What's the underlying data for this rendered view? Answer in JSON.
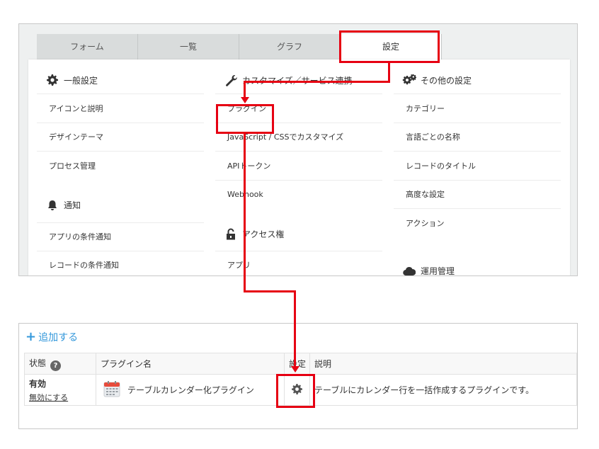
{
  "tabs": [
    {
      "label": "フォーム",
      "active": false
    },
    {
      "label": "一覧",
      "active": false
    },
    {
      "label": "グラフ",
      "active": false
    },
    {
      "label": "設定",
      "active": true
    }
  ],
  "columns": {
    "general": {
      "heading": "一般設定",
      "icon": "gear-icon",
      "items": [
        "アイコンと説明",
        "デザインテーマ",
        "プロセス管理"
      ],
      "sub_heading": "通知",
      "sub_icon": "bell-icon",
      "sub_items": [
        "アプリの条件通知",
        "レコードの条件通知"
      ]
    },
    "customize": {
      "heading": "カスタマイズ／サービス連携",
      "icon": "wrench-icon",
      "items": [
        "プラグイン",
        "JavaScript / CSSでカスタマイズ",
        "APIトークン",
        "Webhook"
      ],
      "sub_heading": "アクセス権",
      "sub_icon": "lock-icon",
      "sub_items": [
        "アプリ"
      ]
    },
    "other": {
      "heading": "その他の設定",
      "icon": "gears-icon",
      "items": [
        "カテゴリー",
        "言語ごとの名称",
        "レコードのタイトル",
        "高度な設定",
        "アクション"
      ],
      "sub_heading": "運用管理",
      "sub_icon": "cloud-icon"
    }
  },
  "plugins": {
    "add_label": "追加する",
    "headers": {
      "status": "状態",
      "name": "プラグイン名",
      "settings": "設定",
      "description": "説明"
    },
    "help_badge": "?",
    "rows": [
      {
        "status": "有効",
        "status_action": "無効にする",
        "name": "テーブルカレンダー化プラグイン",
        "description": "テーブルにカレンダー行を一括作成するプラグインです。"
      }
    ]
  },
  "colors": {
    "highlight": "#e60012",
    "link": "#3498db",
    "tab_inactive": "#d9dcdc"
  }
}
